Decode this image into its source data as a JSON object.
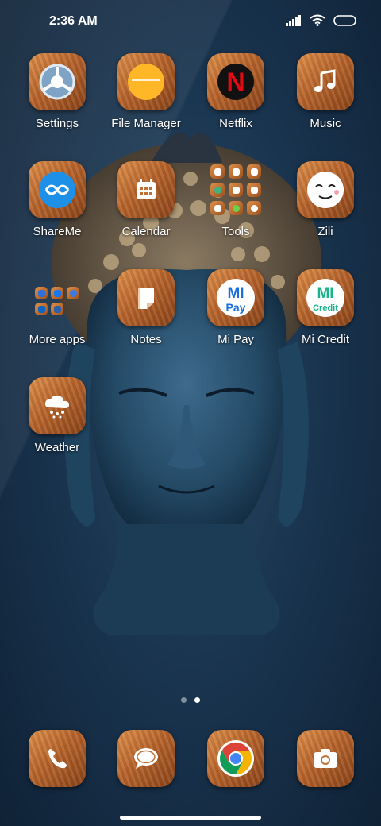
{
  "status_bar": {
    "time": "2:36 AM",
    "icons": [
      "signal-icon",
      "wifi-icon",
      "battery-icon"
    ]
  },
  "apps": {
    "settings": "Settings",
    "file_manager": "File Manager",
    "netflix": "Netflix",
    "music": "Music",
    "shareme": "ShareMe",
    "calendar": "Calendar",
    "tools": "Tools",
    "zili": "Zili",
    "more_apps": "More apps",
    "notes": "Notes",
    "mi_pay": "Mi Pay",
    "mi_credit": "Mi Credit",
    "weather": "Weather"
  },
  "mi_pay_logo": {
    "top": "MI",
    "bottom": "Pay"
  },
  "mi_credit_logo": {
    "top": "MI",
    "bottom": "Credit"
  },
  "netflix_logo": "N",
  "dock": [
    "phone-icon",
    "messages-icon",
    "chrome-icon",
    "camera-icon"
  ],
  "page_indicator": {
    "pages": 2,
    "active": 2
  },
  "colors": {
    "tile_wood": "#b8642b",
    "netflix_red": "#e50914",
    "shareme_blue": "#1e90e8",
    "mipay_blue": "#1a6fe0",
    "micredit_green": "#19b38a"
  }
}
